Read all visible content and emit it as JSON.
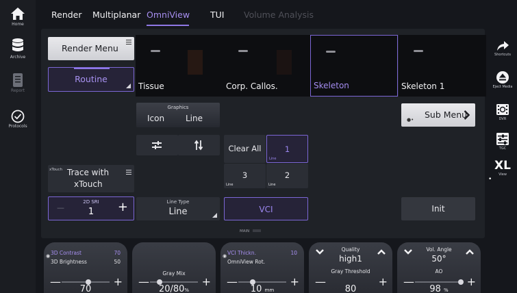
{
  "left_sidebar": {
    "home_label": "Home",
    "archive_label": "Archive",
    "report_label": "Report",
    "protocols_label": "Protocols"
  },
  "tabs": [
    {
      "label": "Render",
      "state": "normal"
    },
    {
      "label": "Multiplanar",
      "state": "normal"
    },
    {
      "label": "OmniView",
      "state": "active"
    },
    {
      "label": "TUI",
      "state": "normal"
    },
    {
      "label": "Volume Analysis",
      "state": "disabled"
    }
  ],
  "panel": {
    "render_menu_label": "Render Menu",
    "routine_label": "Routine",
    "thumbnails": [
      {
        "label": "Tissue",
        "selected": false
      },
      {
        "label": "Corp. Callos.",
        "selected": false
      },
      {
        "label": "Skeleton",
        "selected": true
      },
      {
        "label": "Skeleton 1",
        "selected": false
      }
    ],
    "graphics": {
      "title": "Graphics",
      "icon_label": "Icon",
      "line_label": "Line"
    },
    "sub_menu_label": "Sub Menu",
    "clear_all_label": "Clear All",
    "line_buttons": [
      {
        "value": "1",
        "caption": "Line",
        "selected": true
      },
      {
        "value": "3",
        "caption": "Line",
        "selected": false
      },
      {
        "value": "2",
        "caption": "Line",
        "selected": false
      }
    ],
    "trace": {
      "prefix": "xTouch",
      "line1": "Trace with",
      "line2": "xTouch"
    },
    "sri": {
      "title": "2D SRI",
      "value": "1",
      "minus": "—",
      "plus": "+"
    },
    "line_type": {
      "title": "Line Type",
      "value": "Line"
    },
    "vci_label": "VCI",
    "init_label": "Init",
    "main_caption": "MAIN"
  },
  "knobs": [
    {
      "top1": "3D Contrast",
      "top1_value": "70",
      "top2": "3D Brightness",
      "top2_value": "50",
      "slider_value": "70",
      "unit": "",
      "slider_fraction": 0.55
    },
    {
      "title": "Gray Mix",
      "slider_value": "20/80",
      "unit": "%",
      "slider_fraction": 0.2
    },
    {
      "top1": "VCI Thickn.",
      "top1_value": "10",
      "top2": "OmniView Rot.",
      "slider_value": "10",
      "unit": "mm",
      "slider_fraction": 0.3
    },
    {
      "pick_title": "Quality",
      "pick_value": "high1",
      "title": "Gray Threshold",
      "slider_value": "80",
      "unit": ""
    },
    {
      "pick_title": "Vol. Angle",
      "pick_value": "50°",
      "title": "AO",
      "slider_value": "98",
      "unit": "%",
      "slider_fraction": 0.95
    }
  ],
  "right_sidebar": {
    "shortcuts_label": "Shortcuts",
    "eject_label": "Eject Media",
    "dvr_label": "DVR",
    "tgc_label": "TGC",
    "xl_text": "XL",
    "view_label": "View"
  },
  "colors": {
    "accent": "#8f78e6",
    "panel": "#1f2227",
    "background": "#15171c"
  }
}
